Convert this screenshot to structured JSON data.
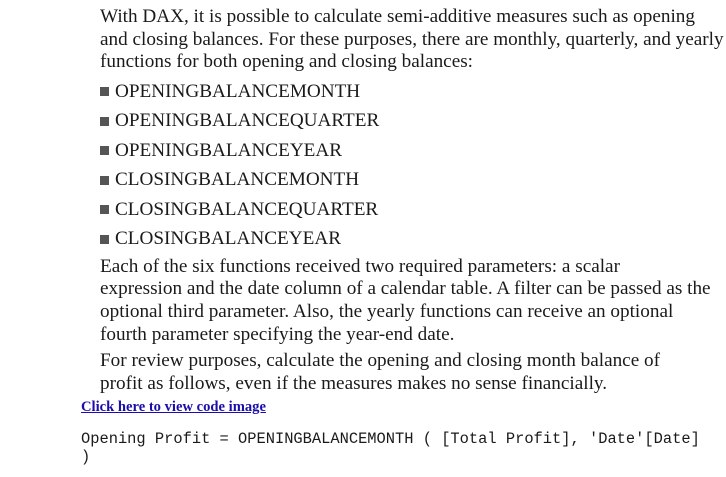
{
  "paragraphs": {
    "intro": {
      "lines": [
        "With DAX, it is possible to calculate semi-additive measures such as opening",
        "and closing balances. For these purposes, there are monthly, quarterly, and yearly",
        "functions for both opening and closing balances:"
      ]
    },
    "params": {
      "lines": [
        "Each of the six functions received two required parameters: a scalar",
        "expression and the date column of a calendar table. A filter can be passed as the",
        "optional third parameter. Also, the yearly functions can receive an optional",
        "fourth parameter specifying the year-end date."
      ]
    },
    "review": {
      "lines": [
        "For review purposes, calculate the opening and closing month balance of",
        "profit as follows, even if the measures makes no sense financially."
      ]
    }
  },
  "functions": [
    "OPENINGBALANCEMONTH",
    "OPENINGBALANCEQUARTER",
    "OPENINGBALANCEYEAR",
    "CLOSINGBALANCEMONTH",
    "CLOSINGBALANCEQUARTER",
    "CLOSINGBALANCEYEAR"
  ],
  "code_link": {
    "label": "Click here to view code image"
  },
  "code": {
    "line1": "Opening Profit = OPENINGBALANCEMONTH ( [Total Profit], 'Date'[Date]",
    "line2": ")"
  },
  "icons": {
    "bullet": "square-bullet-icon"
  },
  "colors": {
    "text": "#1a1a1a",
    "link": "#1a0dab",
    "bullet": "#555555"
  }
}
